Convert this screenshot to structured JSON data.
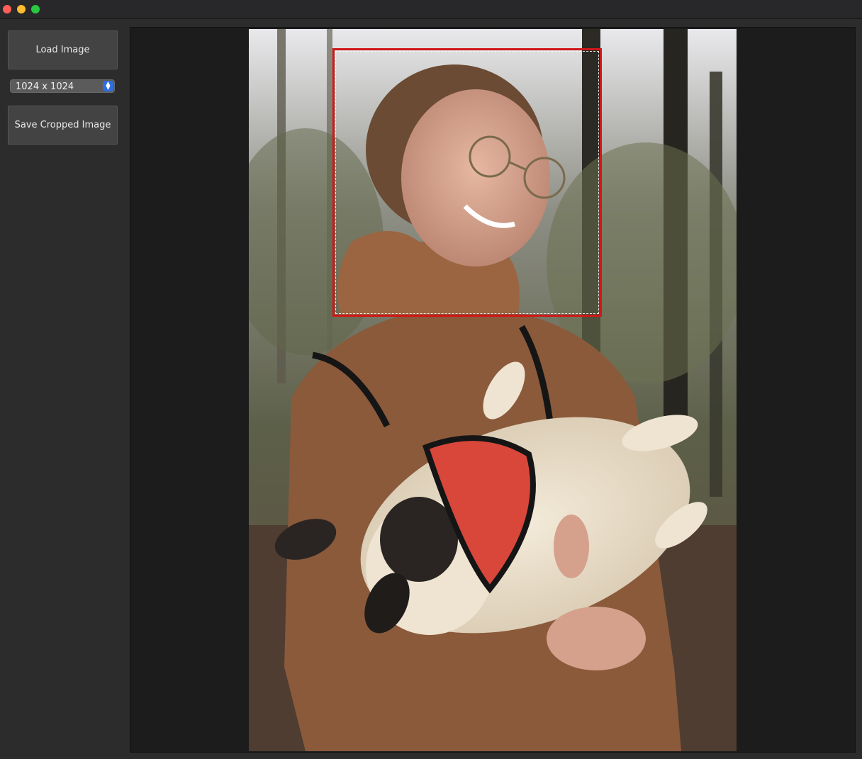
{
  "window": {
    "controls": [
      "close-icon",
      "minimize-icon",
      "maximize-icon"
    ],
    "colors": {
      "close": "#ff5f57",
      "minimize": "#febc2e",
      "maximize": "#28c840"
    }
  },
  "sidebar": {
    "load_label": "Load Image",
    "size_select": {
      "selected": "1024 x 1024",
      "icon": "updown-chevron-icon"
    },
    "save_label": "Save Cropped Image"
  },
  "canvas": {
    "image_description_icon": "photo",
    "crop_color": "#d01818"
  }
}
